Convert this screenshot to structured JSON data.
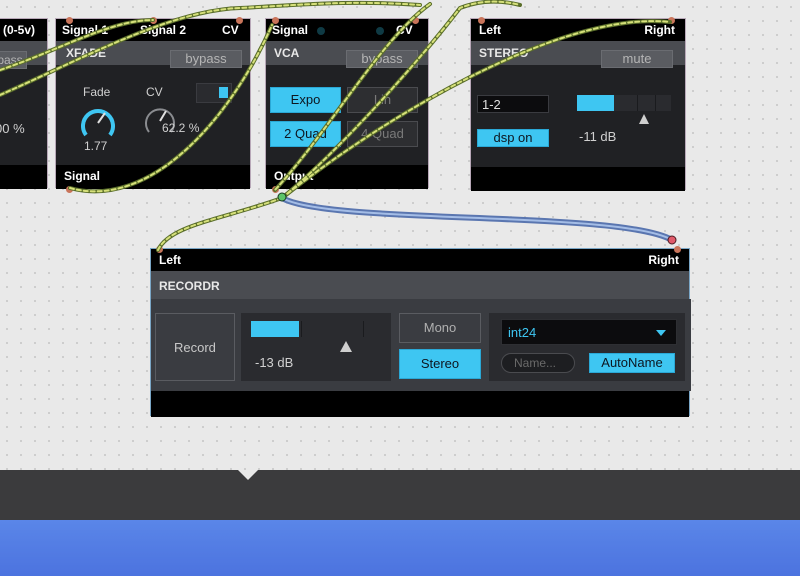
{
  "partial_module": {
    "header_label": "(0-5v)",
    "button_label": "pass",
    "value_label": "00 %"
  },
  "xfade": {
    "inputs": [
      "Signal 1",
      "Signal 2",
      "CV"
    ],
    "title": "XFADE",
    "bypass_label": "bypass",
    "fade_label": "Fade",
    "fade_value": "1.77",
    "cv_label": "CV",
    "cv_value": "62.2 %",
    "output": "Signal"
  },
  "vca": {
    "inputs": [
      "Signal",
      "CV"
    ],
    "title": "VCA",
    "bypass_label": "bypass",
    "expo_label": "Expo",
    "lin_label": "Lin",
    "quad2_label": "2 Quad",
    "quad4_label": "4 Quad",
    "output": "Output"
  },
  "stereo": {
    "inputs": [
      "Left",
      "Right"
    ],
    "title": "STEREO",
    "mute_label": "mute",
    "channel_value": "1-2",
    "dsp_label": "dsp on",
    "db_value": "-11 dB",
    "meter_level": 0.45
  },
  "recordr": {
    "inputs": [
      "Left",
      "Right"
    ],
    "title": "RECORDR",
    "record_label": "Record",
    "db_value": "-13 dB",
    "meter_level": 0.37,
    "mono_label": "Mono",
    "stereo_label": "Stereo",
    "format_value": "int24",
    "name_placeholder": "Name...",
    "autoname_label": "AutoName"
  },
  "colors": {
    "accent": "#3ec6f2",
    "module_bg": "#202124",
    "wire_green": "#c8dc6e",
    "wire_blue": "#8aa6d8"
  }
}
